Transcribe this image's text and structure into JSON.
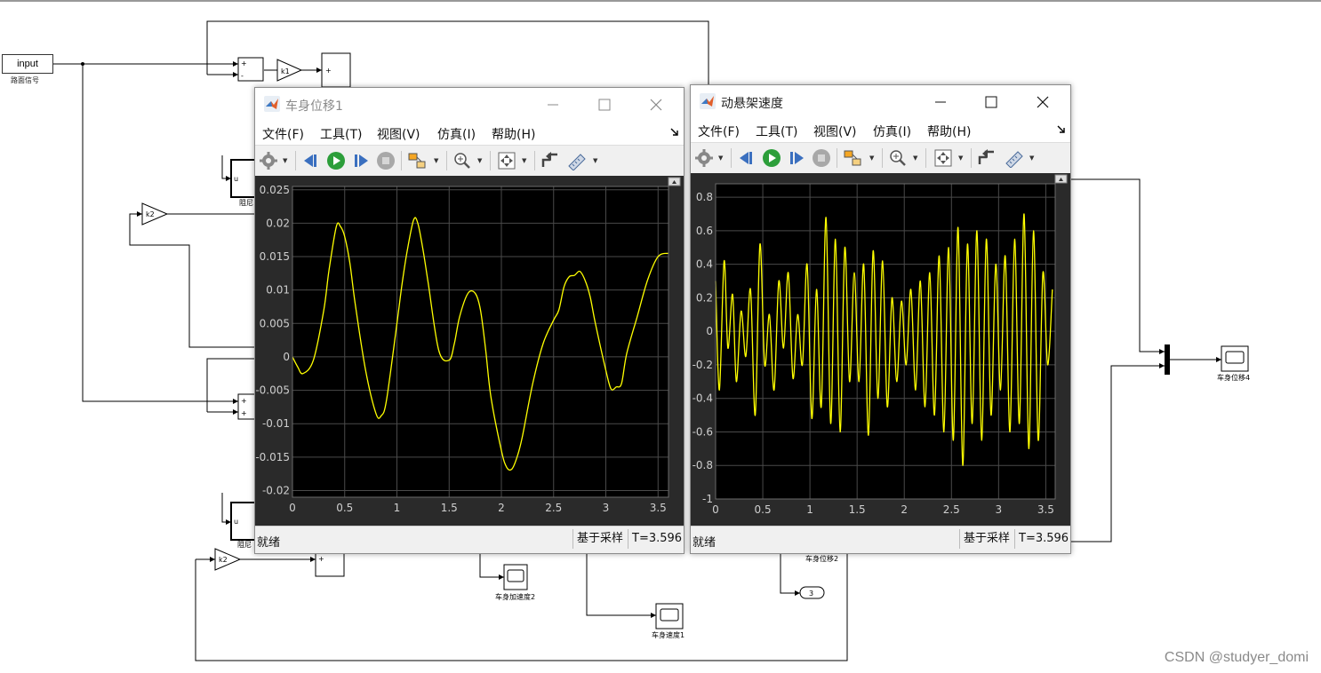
{
  "diagram": {
    "input_label": "input",
    "input_sub": "路面信号",
    "k1": "k1",
    "k2_a": "k2",
    "k2_b": "k2",
    "u_a": "u",
    "u_b": "u",
    "plus": "+",
    "minus": "-",
    "zuni_a": "阻尼",
    "zuni_b": "阻尼",
    "scope_acc2": "车身加速度2",
    "scope_vel1": "车身速度1",
    "scope_disp2": "车身位移2",
    "scope_disp4": "车身位移4",
    "outport": "3"
  },
  "window1": {
    "title": "车身位移1",
    "active": false,
    "menu": [
      "文件(F)",
      "工具(T)",
      "视图(V)",
      "仿真(I)",
      "帮助(H)"
    ],
    "status_left": "就绪",
    "status_mode": "基于采样",
    "status_time": "T=3.596"
  },
  "window2": {
    "title": "动悬架速度",
    "active": true,
    "menu": [
      "文件(F)",
      "工具(T)",
      "视图(V)",
      "仿真(I)",
      "帮助(H)"
    ],
    "status_left": "就绪",
    "status_mode": "基于采样",
    "status_time": "T=3.596"
  },
  "icons": {
    "app": "matlab-logo-icon",
    "settings": "gear-icon",
    "step_back": "step-back-icon",
    "run": "run-icon",
    "step_forward": "step-forward-icon",
    "stop": "stop-icon",
    "highlight": "highlight-block-icon",
    "zoom": "zoom-in-icon",
    "autoscale": "autoscale-icon",
    "triggers": "trigger-icon",
    "cursors": "cursor-measure-icon",
    "undock": "undock-icon"
  },
  "colors": {
    "trace": "#ffff00",
    "plot_bg": "#000000",
    "frame_bg": "#2a2a2a",
    "grid": "#4a4a4a",
    "tick": "#cfcfcf"
  },
  "chart_data": [
    {
      "type": "line",
      "xlim": [
        0,
        3.6
      ],
      "ylim": [
        -0.021,
        0.0255
      ],
      "xticks": [
        "0",
        "0.5",
        "1",
        "1.5",
        "2",
        "2.5",
        "3",
        "3.5"
      ],
      "yticks": [
        "0.025",
        "0.02",
        "0.015",
        "0.01",
        "0.005",
        "0",
        "-0.005",
        "-0.01",
        "-0.015",
        "-0.02"
      ],
      "grid": true,
      "series": [
        {
          "x": [
            0,
            0.05,
            0.1,
            0.2,
            0.3,
            0.35,
            0.42,
            0.46,
            0.5,
            0.55,
            0.6,
            0.7,
            0.8,
            0.85,
            0.9,
            1.0,
            1.05,
            1.1,
            1.16,
            1.2,
            1.25,
            1.3,
            1.4,
            1.5,
            1.55,
            1.6,
            1.68,
            1.75,
            1.8,
            1.85,
            1.9,
            2.0,
            2.05,
            2.1,
            2.15,
            2.2,
            2.3,
            2.4,
            2.5,
            2.55,
            2.6,
            2.65,
            2.7,
            2.75,
            2.8,
            2.85,
            2.9,
            3.0,
            3.05,
            3.1,
            3.15,
            3.2,
            3.3,
            3.4,
            3.5,
            3.6
          ],
          "y": [
            0,
            -0.0015,
            -0.0025,
            -0.0005,
            0.007,
            0.013,
            0.0195,
            0.0195,
            0.018,
            0.014,
            0.008,
            -0.002,
            -0.0085,
            -0.0088,
            -0.0065,
            0.005,
            0.011,
            0.016,
            0.0205,
            0.02,
            0.016,
            0.011,
            0.001,
            -0.0005,
            0.002,
            0.006,
            0.0095,
            0.0095,
            0.007,
            0.001,
            -0.006,
            -0.014,
            -0.0165,
            -0.0168,
            -0.015,
            -0.012,
            -0.004,
            0.002,
            0.0055,
            0.007,
            0.0105,
            0.012,
            0.0122,
            0.0128,
            0.0115,
            0.009,
            0.005,
            -0.002,
            -0.0048,
            -0.0045,
            -0.004,
            0.0005,
            0.006,
            0.0115,
            0.015,
            0.0155
          ]
        }
      ]
    },
    {
      "type": "line",
      "xlim": [
        0,
        3.6
      ],
      "ylim": [
        -1,
        0.88
      ],
      "xticks": [
        "0",
        "0.5",
        "1",
        "1.5",
        "2",
        "2.5",
        "3",
        "3.5"
      ],
      "yticks": [
        "0.8",
        "0.6",
        "0.4",
        "0.2",
        "0",
        "-0.2",
        "-0.4",
        "-0.6",
        "-0.8",
        "-1"
      ],
      "grid": true,
      "series": [
        {
          "x": [
            0,
            0.04,
            0.09,
            0.13,
            0.18,
            0.22,
            0.27,
            0.32,
            0.37,
            0.42,
            0.47,
            0.52,
            0.57,
            0.62,
            0.67,
            0.72,
            0.77,
            0.82,
            0.87,
            0.92,
            0.97,
            1.02,
            1.07,
            1.12,
            1.17,
            1.22,
            1.27,
            1.32,
            1.37,
            1.42,
            1.47,
            1.52,
            1.57,
            1.62,
            1.67,
            1.72,
            1.77,
            1.82,
            1.87,
            1.92,
            1.97,
            2.02,
            2.07,
            2.12,
            2.17,
            2.22,
            2.27,
            2.32,
            2.37,
            2.42,
            2.47,
            2.52,
            2.57,
            2.62,
            2.67,
            2.72,
            2.77,
            2.82,
            2.87,
            2.92,
            2.97,
            3.02,
            3.07,
            3.12,
            3.17,
            3.22,
            3.27,
            3.32,
            3.37,
            3.42,
            3.47,
            3.52,
            3.57
          ],
          "y": [
            0.3,
            -0.35,
            0.42,
            -0.1,
            0.22,
            -0.3,
            0.12,
            -0.15,
            0.25,
            -0.5,
            0.52,
            -0.2,
            0.1,
            -0.35,
            0.3,
            -0.1,
            0.35,
            -0.28,
            0.1,
            -0.2,
            0.4,
            -0.52,
            0.25,
            -0.45,
            0.68,
            -0.55,
            0.55,
            -0.6,
            0.5,
            -0.3,
            0.35,
            -0.3,
            0.4,
            -0.62,
            0.48,
            -0.4,
            0.42,
            -0.45,
            0.2,
            -0.3,
            0.18,
            -0.2,
            0.25,
            -0.35,
            0.3,
            -0.45,
            0.35,
            -0.5,
            0.45,
            -0.6,
            0.5,
            -0.65,
            0.62,
            -0.8,
            0.52,
            -0.55,
            0.6,
            -0.65,
            0.55,
            -0.5,
            0.4,
            -0.35,
            0.45,
            -0.6,
            0.55,
            -0.55,
            0.7,
            -0.7,
            0.6,
            -0.65,
            0.35,
            -0.2,
            0.25
          ]
        }
      ]
    }
  ],
  "watermark": "CSDN @studyer_domi"
}
